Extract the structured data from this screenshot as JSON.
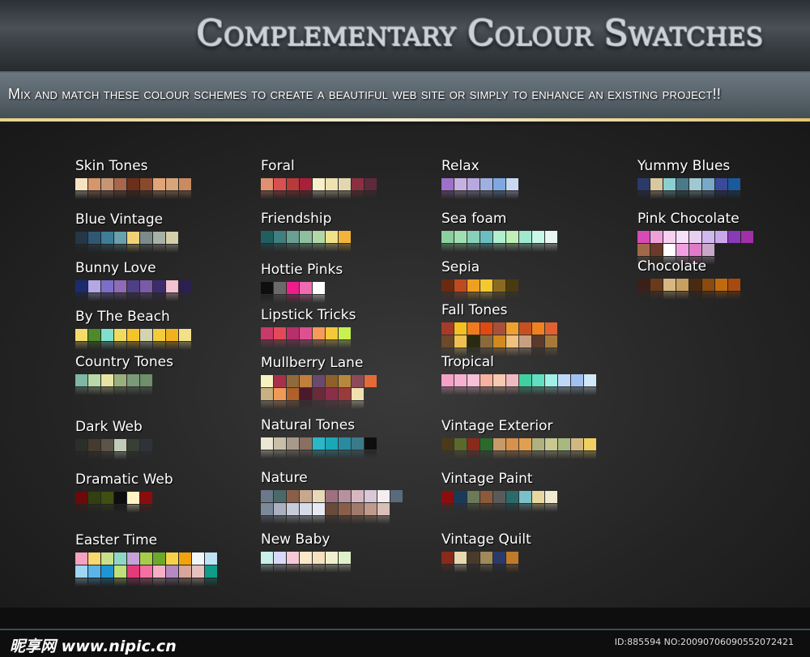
{
  "header": {
    "title": "Complementary Colour Swatches",
    "subtitle": "Mix and match these colour schemes to create a beautiful web site or simply to enhance an existing project!!"
  },
  "footer": {
    "watermark_cn": "昵享网",
    "watermark_url": "www.nipic.cn",
    "id_text": "ID:885594 NO:20090706090552072421"
  },
  "columns": [
    [
      {
        "name": "Skin Tones",
        "rows": [
          [
            "#f5e3c3",
            "#d6956a",
            "#c59576",
            "#a6674a",
            "#6b2f1a",
            "#8a4a2a",
            "#e2a577",
            "#d7a47b",
            "#c98b60"
          ]
        ]
      },
      {
        "name": "Blue Vintage",
        "rows": [
          [
            "#243745",
            "#2f5875",
            "#3d7d97",
            "#6aa0ab",
            "#f0d276",
            "#7c8a8a",
            "#a7b2a7",
            "#d4cfa8"
          ]
        ]
      },
      {
        "name": "Bunny Love",
        "rows": [
          [
            "#1b2b6e",
            "#b3a7e6",
            "#7a6fc9",
            "#8f6bb8",
            "#4e3f87",
            "#7a5ba8",
            "#3c2c6e",
            "#f2c2cf",
            "#2a1f4e"
          ]
        ]
      },
      {
        "name": "By The Beach",
        "rows": [
          [
            "#f4dc6a",
            "#4d8a2a",
            "#7fe0cc",
            "#efdc5c",
            "#f5c42b",
            "#d4d4b0",
            "#f2cc3a",
            "#f2b21f",
            "#f3e08a"
          ]
        ]
      },
      {
        "name": "Country Tones",
        "rows": [
          [
            "#7fb7a2",
            "#b9d9a8",
            "#e8e4a4",
            "#9ab07c",
            "#7b9a7a",
            "#6f8e6a"
          ]
        ]
      },
      {
        "name": "Dark Web",
        "rows": [
          [
            "#2a2f2a",
            "#473a2e",
            "#5a5548",
            "#c2cbb8",
            "#383f36",
            "#2f3338"
          ]
        ]
      },
      {
        "name": "Dramatic Web",
        "rows": [
          [
            "#6b0a0a",
            "#343f10",
            "#3f4f0f",
            "#0e0e0e",
            "#fff4c4",
            "#8a0d0d"
          ]
        ]
      },
      {
        "name": "Easter Time",
        "rows": [
          [
            "#f5a1c2",
            "#f8d770",
            "#c9e08b",
            "#8fd7c5",
            "#c6a1d8",
            "#a5cd4a",
            "#6ea82a",
            "#f5d24a",
            "#f2a20c",
            "#f1f6fa",
            "#bde3f5"
          ],
          [
            "#9fd6f2",
            "#5ab5e6",
            "#1e96d4",
            "#bfe07a",
            "#e23b79",
            "#f56fa3",
            "#f5b0c8",
            "#b58ac2",
            "#d8a69a",
            "#e6c2bf",
            "#0f9c88"
          ]
        ]
      }
    ],
    [
      {
        "name": "Foral",
        "rows": [
          [
            "#e09070",
            "#d95050",
            "#b83a3a",
            "#a9203a",
            "#f7f0c8",
            "#ede2b0",
            "#e3d6b0",
            "#8a3040",
            "#5e2a3a"
          ]
        ]
      },
      {
        "name": "Friendship",
        "rows": [
          [
            "#1f5f5f",
            "#3f7f7f",
            "#6a9f92",
            "#8fbf9f",
            "#b3d8a8",
            "#f0e28a",
            "#f2b53a"
          ]
        ]
      },
      {
        "name": "Hottie Pinks",
        "rows": [
          [
            "#0e0e0e",
            "#6a6a6a",
            "#f01c8c",
            "#f06ab0",
            "#ffffff"
          ]
        ]
      },
      {
        "name": "Lipstick Tricks",
        "rows": [
          [
            "#c83a6a",
            "#e24a5a",
            "#b82f6a",
            "#e04f8f",
            "#f59a5a",
            "#f5c83a",
            "#c8f050"
          ]
        ]
      },
      {
        "name": "Mullberry Lane",
        "rows": [
          [
            "#f7f2c0",
            "#a8304a",
            "#8f6a3a",
            "#c07f3a",
            "#6a4a6a",
            "#8f5f2a",
            "#b8883a",
            "#8a4a5a",
            "#e56a3a"
          ],
          [
            "#c8b080",
            "#f09a5a",
            "#b0602a",
            "#4a1a2a",
            "#6a2a3a",
            "#8a2f4a",
            "#9a3a3a",
            "#f0e0b0"
          ]
        ]
      },
      {
        "name": "Natural Tones",
        "rows": [
          [
            "#ede6d4",
            "#c9bfa8",
            "#a8998a",
            "#8a7060",
            "#2ab8c8",
            "#1aa8b8",
            "#2a8aa0",
            "#3a7a8a",
            "#0e0e0e"
          ]
        ]
      },
      {
        "name": "Nature",
        "rows": [
          [
            "#6a7a8a",
            "#4a6a6a",
            "#8a5f4a",
            "#c8a88a",
            "#e8d8b8",
            "#a07080",
            "#b890a0",
            "#d8b8c0",
            "#d8c8d8",
            "#f5eef0",
            "#5a6a7a"
          ],
          [
            "#7a8a9a",
            "#aab0c0",
            "#c8ccd8",
            "#d8dbe8",
            "#e8eaf2",
            "#6a4a3a",
            "#8a5f4a",
            "#a07a6a",
            "#c09a8a",
            "#d8c0b8"
          ]
        ]
      },
      {
        "name": "New Baby",
        "rows": [
          [
            "#c8f0e8",
            "#d8d8f8",
            "#f5c8d8",
            "#f8e8c8",
            "#f5e0c0",
            "#f0f0d0",
            "#e0f0c8"
          ]
        ]
      }
    ],
    [
      {
        "name": "Relax",
        "rows": [
          [
            "#9f70c8",
            "#c8b0e0",
            "#b8a8e0",
            "#9fb0e0",
            "#7fa8e0",
            "#c8d8f0"
          ]
        ]
      },
      {
        "name": "Sea foam",
        "rows": [
          [
            "#8ad0a0",
            "#a0e0b0",
            "#8ad0b8",
            "#6ac0c0",
            "#b0f0d0",
            "#c0f0b8",
            "#a0e8d0",
            "#c8f8e8",
            "#e8f8f0"
          ]
        ]
      },
      {
        "name": "Sepia",
        "rows": [
          [
            "#6a2a10",
            "#c04a20",
            "#f0a020",
            "#f5c830",
            "#8a6a20",
            "#4a3a10"
          ]
        ]
      },
      {
        "name": "Fall Tones",
        "rows": [
          [
            "#a83a2a",
            "#f5c020",
            "#f07a20",
            "#e04a10",
            "#a8503a",
            "#f0a030",
            "#c85020",
            "#f08020",
            "#e06030"
          ],
          [
            "#6a4a2a",
            "#f0c050",
            "#2a2a10",
            "#8a6a3a",
            "#d08a20",
            "#f0c080",
            "#c8a080",
            "#5a3a2a",
            "#a87a3a"
          ]
        ]
      },
      {
        "name": "Tropical",
        "rows": [
          [
            "#f5a0c8",
            "#f8b0d0",
            "#f5c0d8",
            "#f8b0a0",
            "#f8c8b0",
            "#f0b8c0",
            "#40d0a0",
            "#60e0c0",
            "#a0f0e8",
            "#c0d8f8",
            "#a0c0f0",
            "#d0e8f8"
          ]
        ]
      },
      {
        "name": "Vintage Exterior",
        "rows": [
          [
            "#4a3a1a",
            "#5a6a2a",
            "#8a2a1a",
            "#2a6a2a",
            "#c89a6a",
            "#d8904a",
            "#e0a050",
            "#b0b080",
            "#c8c890",
            "#a8b880",
            "#d0b880",
            "#f0d060"
          ]
        ]
      },
      {
        "name": "Vintage Paint",
        "rows": [
          [
            "#8a0e0e",
            "#1a3a5a",
            "#6a7a5a",
            "#8a5a3a",
            "#5a5a5a",
            "#2a6a6a",
            "#7ac0c8",
            "#e8d8a0",
            "#f0ead0"
          ]
        ]
      },
      {
        "name": "Vintage Quilt",
        "rows": [
          [
            "#8a2a1a",
            "#e8d8b0",
            "#4a3a2a",
            "#a08a5a",
            "#2a3a6a",
            "#c07a2a"
          ]
        ]
      }
    ],
    [
      {
        "name": "Yummy Blues",
        "rows": [
          [
            "#2a3a6a",
            "#d8c8a0",
            "#8ad0d0",
            "#4a7a8a",
            "#a0c8d0",
            "#7aa8c8",
            "#3a4a9a",
            "#1a5a9a"
          ]
        ]
      },
      {
        "name": "Pink Chocolate",
        "rows": [
          [
            "#d84ab8",
            "#f0a0d8",
            "#f8d0f0",
            "#f8e0f8",
            "#e8d0f0",
            "#d0b8f0",
            "#c8a8e8",
            "#8a3ab8",
            "#a030a8"
          ],
          [
            "#a06a4a",
            "#6a3a2a",
            "#ffffff",
            "#f0a0e0",
            "#e07ac8",
            "#c8a8c8"
          ]
        ]
      },
      {
        "name": "Chocolate",
        "rows": [
          [
            "#3a2018",
            "#6a3a1a",
            "#d8b880",
            "#c8a060",
            "#4a2a10",
            "#8a4a10",
            "#c06a10",
            "#a84a10"
          ]
        ]
      }
    ]
  ]
}
